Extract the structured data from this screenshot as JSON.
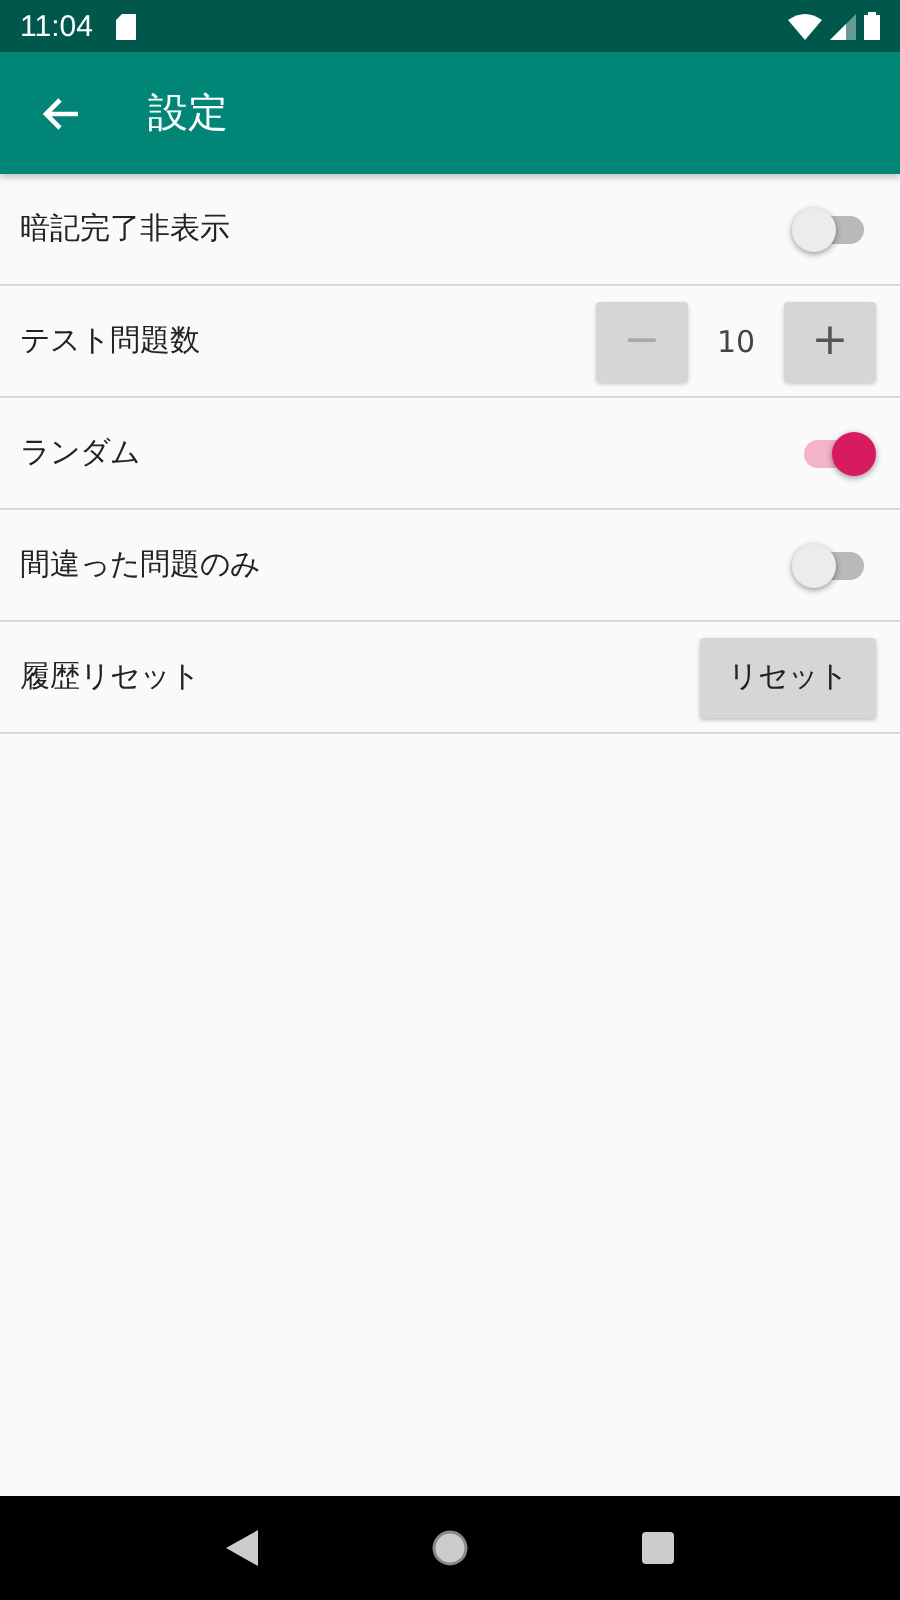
{
  "status_bar": {
    "time": "11:04"
  },
  "app_bar": {
    "title": "設定"
  },
  "settings": [
    {
      "kind": "toggle",
      "label": "暗記完了非表示",
      "on": false
    },
    {
      "kind": "stepper",
      "label": "テスト問題数",
      "value": "10",
      "minus": {
        "label": "−",
        "disabled": true
      },
      "plus": {
        "label": "+",
        "disabled": false
      }
    },
    {
      "kind": "toggle",
      "label": "ランダム",
      "on": true
    },
    {
      "kind": "toggle",
      "label": "間違った問題のみ",
      "on": false
    },
    {
      "kind": "button",
      "label": "履歴リセット",
      "button": "リセット"
    }
  ]
}
